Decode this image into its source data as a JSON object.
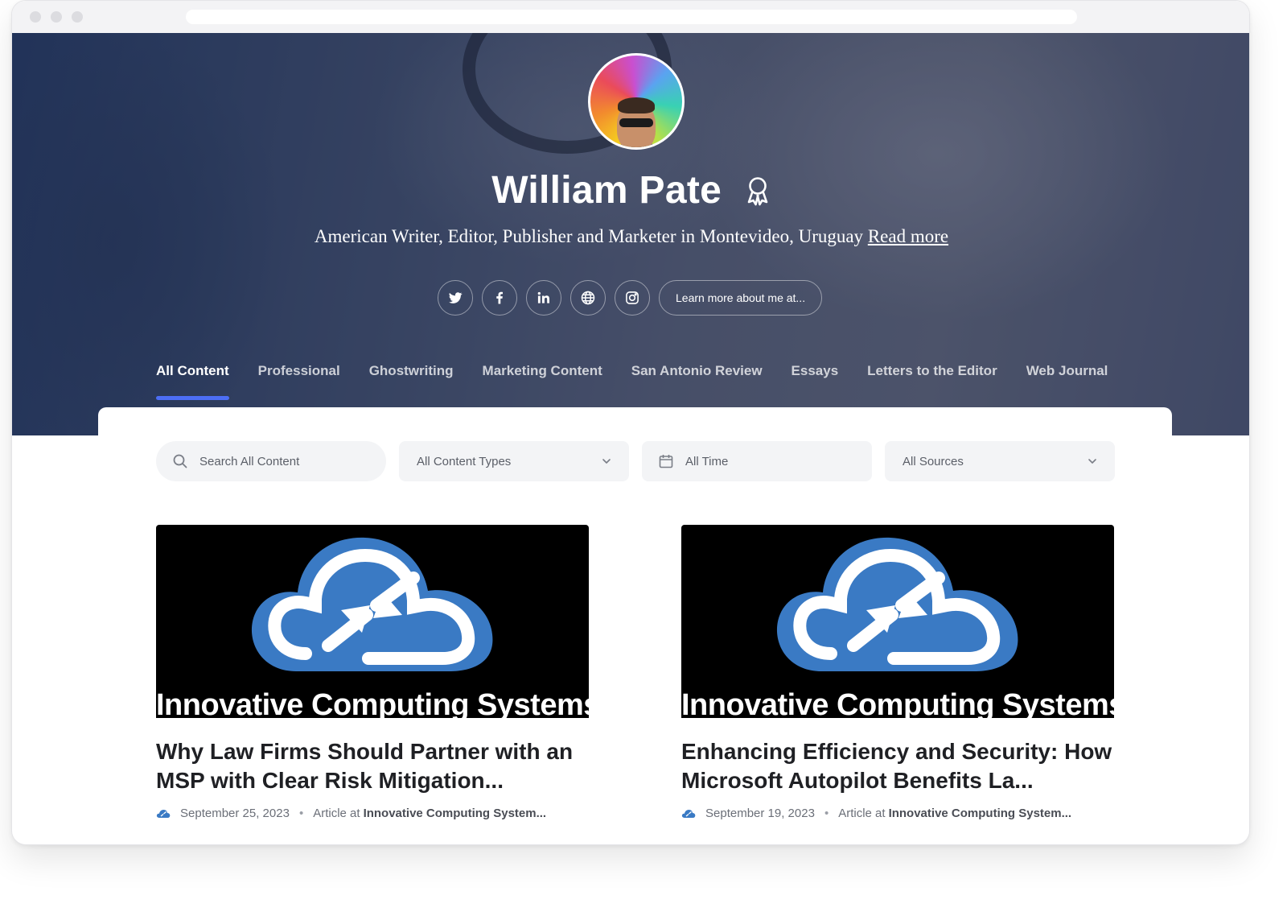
{
  "profile": {
    "name": "William Pate",
    "bio": "American Writer, Editor, Publisher and Marketer in Montevideo, Uruguay",
    "read_more": "Read more",
    "learn_more": "Learn more about me at...",
    "social_icons": [
      "twitter-icon",
      "facebook-icon",
      "linkedin-icon",
      "globe-icon",
      "instagram-icon"
    ]
  },
  "tabs": [
    {
      "label": "All Content",
      "active": true
    },
    {
      "label": "Professional"
    },
    {
      "label": "Ghostwriting"
    },
    {
      "label": "Marketing Content"
    },
    {
      "label": "San Antonio Review"
    },
    {
      "label": "Essays"
    },
    {
      "label": "Letters to the Editor"
    },
    {
      "label": "Web Journal"
    }
  ],
  "filters": {
    "search_placeholder": "Search All Content",
    "content_types": "All Content Types",
    "time": "All Time",
    "sources": "All Sources"
  },
  "cards": [
    {
      "thumb_text": "Innovative Computing Systems",
      "title": "Why Law Firms Should Partner with an MSP with Clear Risk Mitigation...",
      "date": "September 25, 2023",
      "type": "Article at",
      "source": "Innovative Computing System..."
    },
    {
      "thumb_text": "Innovative Computing Systems",
      "title": "Enhancing Efficiency and Security: How Microsoft Autopilot Benefits La...",
      "date": "September 19, 2023",
      "type": "Article at",
      "source": "Innovative Computing System..."
    }
  ],
  "colors": {
    "accent": "#4c6ef5",
    "cloud_blue": "#3a7ac4"
  }
}
